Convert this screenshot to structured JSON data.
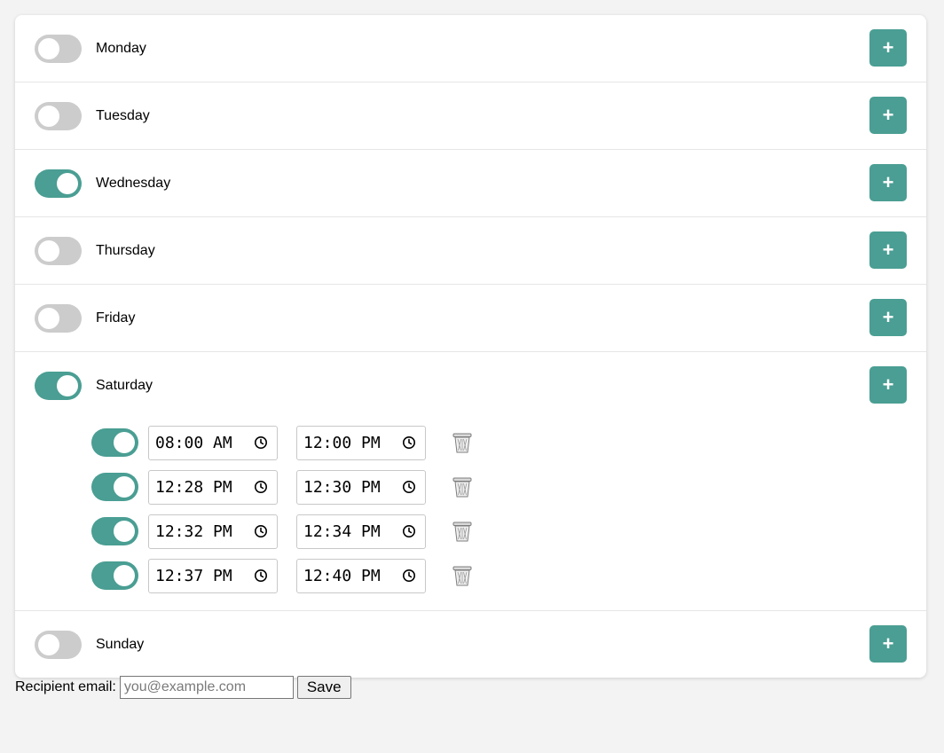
{
  "colors": {
    "accent": "#4a9e93",
    "toggle_off": "#cccccc",
    "background": "#f3f3f3"
  },
  "days": [
    {
      "label": "Monday",
      "enabled": false,
      "add_label": "+"
    },
    {
      "label": "Tuesday",
      "enabled": false,
      "add_label": "+"
    },
    {
      "label": "Wednesday",
      "enabled": true,
      "add_label": "+"
    },
    {
      "label": "Thursday",
      "enabled": false,
      "add_label": "+"
    },
    {
      "label": "Friday",
      "enabled": false,
      "add_label": "+"
    },
    {
      "label": "Saturday",
      "enabled": true,
      "add_label": "+",
      "slots": [
        {
          "enabled": true,
          "start": "08:00 AM",
          "end": "12:00 PM"
        },
        {
          "enabled": true,
          "start": "12:28 PM",
          "end": "12:30 PM"
        },
        {
          "enabled": true,
          "start": "12:32 PM",
          "end": "12:34 PM"
        },
        {
          "enabled": true,
          "start": "12:37 PM",
          "end": "12:40 PM"
        }
      ]
    },
    {
      "label": "Sunday",
      "enabled": false,
      "add_label": "+"
    }
  ],
  "footer": {
    "email_label": "Recipient email:",
    "email_placeholder": "you@example.com",
    "email_value": "",
    "save_label": "Save"
  },
  "icons": {
    "add": "plus-icon",
    "clock": "clock-icon",
    "delete": "trash-icon"
  }
}
